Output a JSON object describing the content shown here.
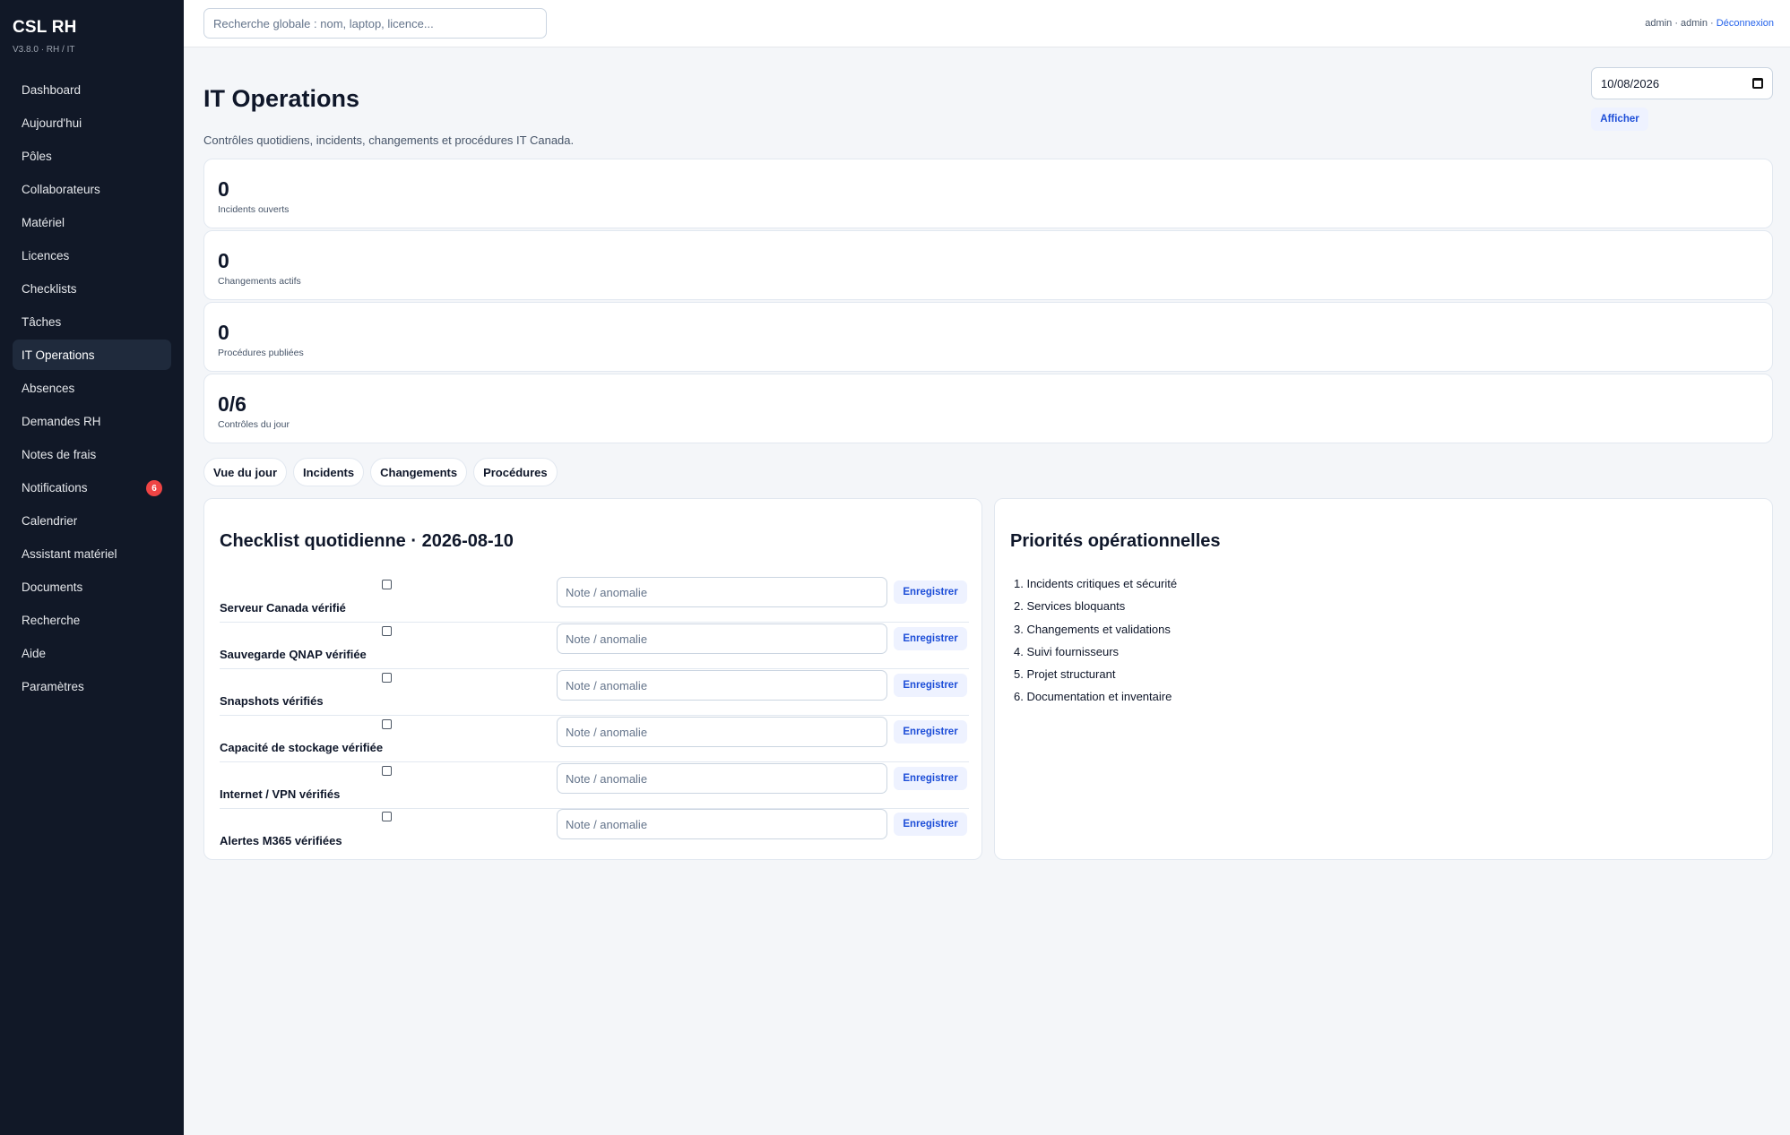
{
  "sidebar": {
    "brand": "CSL RH",
    "version": "V3.8.0 · RH / IT",
    "items": [
      {
        "label": "Dashboard"
      },
      {
        "label": "Aujourd'hui"
      },
      {
        "label": "Pôles"
      },
      {
        "label": "Collaborateurs"
      },
      {
        "label": "Matériel"
      },
      {
        "label": "Licences"
      },
      {
        "label": "Checklists"
      },
      {
        "label": "Tâches"
      },
      {
        "label": "IT Operations",
        "active": true
      },
      {
        "label": "Absences"
      },
      {
        "label": "Demandes RH"
      },
      {
        "label": "Notes de frais"
      },
      {
        "label": "Notifications",
        "badge": "6"
      },
      {
        "label": "Calendrier"
      },
      {
        "label": "Assistant matériel"
      },
      {
        "label": "Documents"
      },
      {
        "label": "Recherche"
      },
      {
        "label": "Aide"
      },
      {
        "label": "Paramètres"
      }
    ]
  },
  "topbar": {
    "search_placeholder": "Recherche globale : nom, laptop, licence...",
    "user": "admin · admin · ",
    "logout": "Déconnexion"
  },
  "page": {
    "title": "IT Operations",
    "subtitle": "Contrôles quotidiens, incidents, changements et procédures IT Canada.",
    "date_value": "10/08/2026",
    "show_label": "Afficher"
  },
  "stats": [
    {
      "value": "0",
      "label": "Incidents ouverts"
    },
    {
      "value": "0",
      "label": "Changements actifs"
    },
    {
      "value": "0",
      "label": "Procédures publiées"
    },
    {
      "value": "0/6",
      "label": "Contrôles du jour"
    }
  ],
  "tabs": [
    {
      "label": "Vue du jour"
    },
    {
      "label": "Incidents"
    },
    {
      "label": "Changements"
    },
    {
      "label": "Procédures"
    }
  ],
  "checklist": {
    "title": "Checklist quotidienne · 2026-08-10",
    "note_placeholder": "Note / anomalie",
    "save_label": "Enregistrer",
    "items": [
      {
        "label": "Serveur Canada vérifié"
      },
      {
        "label": "Sauvegarde QNAP vérifiée"
      },
      {
        "label": "Snapshots vérifiés"
      },
      {
        "label": "Capacité de stockage vérifiée"
      },
      {
        "label": "Internet / VPN vérifiés"
      },
      {
        "label": "Alertes M365 vérifiées"
      }
    ]
  },
  "priorities": {
    "title": "Priorités opérationnelles",
    "items": [
      "1. Incidents critiques et sécurité",
      "2. Services bloquants",
      "3. Changements et validations",
      "4. Suivi fournisseurs",
      "5. Projet structurant",
      "6. Documentation et inventaire"
    ]
  }
}
